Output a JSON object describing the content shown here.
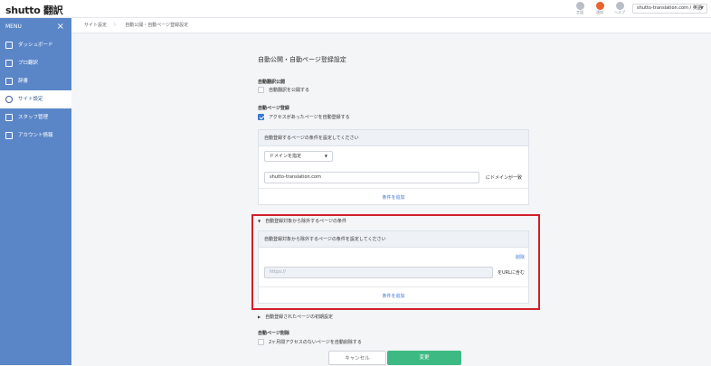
{
  "app": {
    "logo": "shutto 翻訳"
  },
  "topbar": {
    "icons": [
      {
        "name": "globe-icon",
        "label": "言語"
      },
      {
        "name": "notification-icon",
        "label": "通知"
      },
      {
        "name": "help-icon",
        "label": "ヘルプ"
      }
    ],
    "domain_select": "shutto-translation.com / 英語"
  },
  "sidebar": {
    "menu_label": "MENU",
    "items": [
      {
        "label": "ダッシュボード"
      },
      {
        "label": "プロ翻訳"
      },
      {
        "label": "辞書"
      },
      {
        "label": "サイト設定",
        "active": true
      },
      {
        "label": "スタッフ管理"
      },
      {
        "label": "アカウント情報"
      }
    ]
  },
  "breadcrumb": {
    "root": "サイト設定",
    "current": "自動公開・自動ページ登録設定"
  },
  "page": {
    "title": "自動公開・自動ページ登録設定",
    "auto_publish": {
      "label": "自動翻訳公開",
      "checkbox_label": "自動翻訳を公開する",
      "checked": false
    },
    "auto_register": {
      "label": "自動ページ登録",
      "checkbox_label": "アクセスがあったページを自動登録する",
      "checked": true
    },
    "register_conditions": {
      "header": "自動登録するページの条件を設定してください",
      "select_value": "ドメインを指定",
      "input_value": "shutto-translation.com",
      "suffix": "にドメインが一致",
      "add_label": "条件を追加"
    },
    "exclude_section": {
      "toggle_label": "自動登録対象から除外するページの条件",
      "header": "自動登録対象から除外するページの条件を設定してください",
      "delete_label": "削除",
      "input_placeholder": "https://",
      "suffix": "をURLに含む",
      "add_label": "条件を追加"
    },
    "initial_settings": {
      "toggle_label": "自動登録されたページの初期設定"
    },
    "auto_delete": {
      "label": "自動ページ削除",
      "checkbox_label": "2ヶ月間アクセスのないページを自動削除する",
      "checked": false
    },
    "buttons": {
      "cancel": "キャンセル",
      "save": "変更"
    }
  },
  "colors": {
    "sidebar": "#5a86c8",
    "accent": "#3a78d1",
    "save": "#3dba84",
    "highlight": "#d0202a"
  }
}
